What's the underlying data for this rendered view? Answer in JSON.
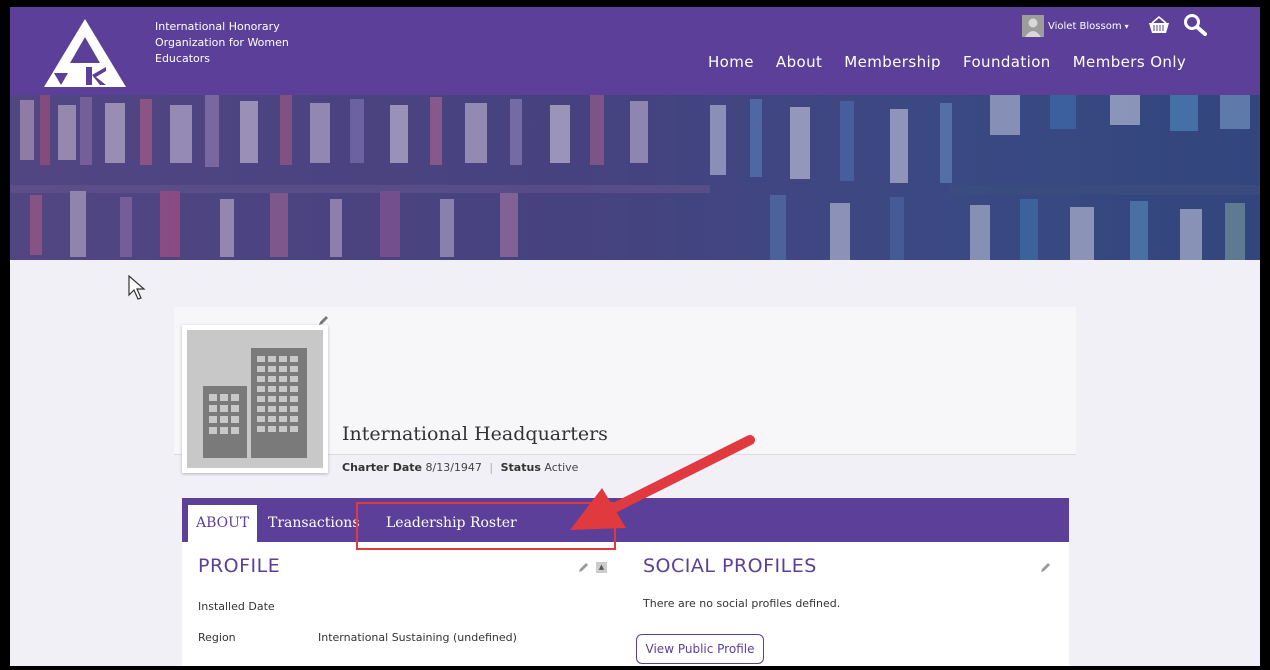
{
  "org": {
    "name_lines": [
      "International Honorary",
      "Organization for Women",
      "Educators"
    ]
  },
  "user": {
    "name": "Violet Blossom"
  },
  "nav": {
    "items": [
      "Home",
      "About",
      "Membership",
      "Foundation",
      "Members Only"
    ]
  },
  "profile": {
    "name": "International Headquarters",
    "charter_date_label": "Charter Date",
    "charter_date": "8/13/1947",
    "status_label": "Status",
    "status": "Active"
  },
  "tabs": [
    "ABOUT",
    "Transactions",
    "Leadership Roster"
  ],
  "profile_section": {
    "title": "PROFILE",
    "fields": [
      {
        "label": "Installed Date",
        "value": ""
      },
      {
        "label": "Region",
        "value": "International Sustaining (undefined)"
      }
    ]
  },
  "social_section": {
    "title": "SOCIAL PROFILES",
    "empty_text": "There are no social profiles defined.",
    "button_label": "View Public Profile"
  },
  "colors": {
    "brand_purple": "#5b3f98",
    "annotation_red": "#e0393e"
  }
}
